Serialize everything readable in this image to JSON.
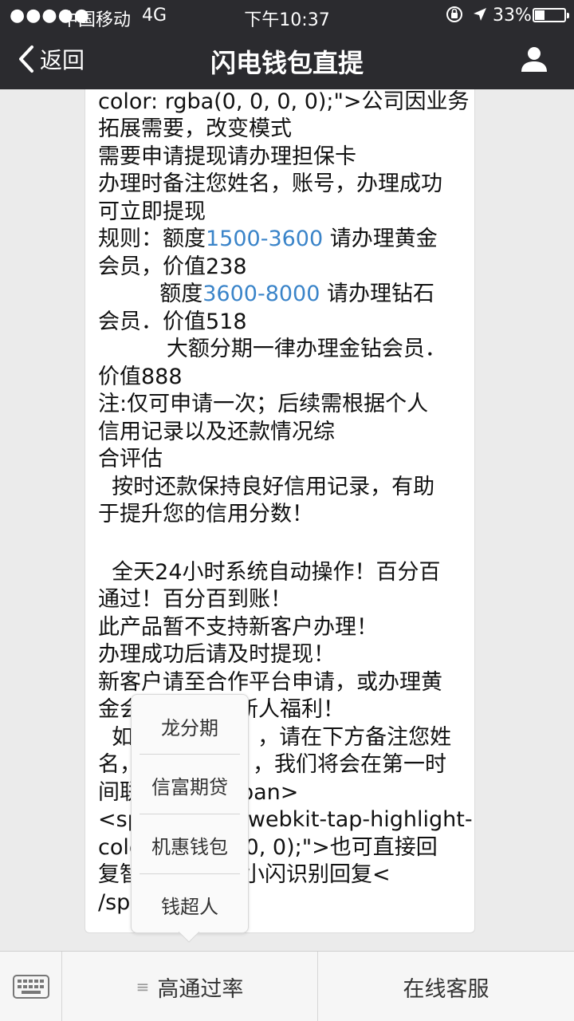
{
  "status_bar": {
    "signal": "●●●●●",
    "carrier": "中国移动",
    "network": "4G",
    "time": "下午10:37",
    "battery_percent_text": "33%",
    "battery_level": 0.33
  },
  "nav": {
    "back_label": "返回",
    "title": "闪电钱包直提"
  },
  "message": {
    "l1": "color: rgba(0, 0, 0, 0);\">公司因业务",
    "l2": "拓展需要，改变模式",
    "l3": "需要申请提现请办理担保卡",
    "l4": "办理时备注您姓名，账号，办理成功",
    "l5": "可立即提现",
    "l6_a": "规则：额度",
    "l6_b": "1500-3600",
    "l6_c": " 请办理黄金",
    "l7": "会员，价值238",
    "l8_a": "         额度",
    "l8_b": "3600-8000",
    "l8_c": " 请办理钻石",
    "l9": "会员．价值518",
    "l10": "          大额分期一律办理金钻会员．",
    "l11": "价值888",
    "l12": "注:仅可申请一次；后续需根据个人",
    "l13": "信用记录以及还款情况综",
    "l14": "合评估",
    "l15": "  按时还款保持良好信用记录，有助",
    "l16": "于提升您的信用分数！",
    "l17": "  全天24小时系统自动操作！百分百",
    "l18": "通过！百分百到账！",
    "l19": "此产品暂不支持新客户办理！",
    "l20": "办理成功后请及时提现！",
    "l21": "新客户请至合作平台申请，或办理黄",
    "l22_a": "金会",
    "l22_b": "新人福利！",
    "l23_a": "  如",
    "l23_b": "，请在下方备注您姓",
    "l24_a": "名，",
    "l24_b": "，我们将会在第一时",
    "l25_a": "间联",
    "l25_b": "pan>",
    "l26_a": "<sp",
    "l26_b": "webkit-tap-highlight-",
    "l27_a": "colo",
    "l27_b": ", 0, 0);\">也可直接回",
    "l28_a": "复智",
    "l28_b": "小闪识别回复<",
    "l29": "/sp"
  },
  "popup_menu": {
    "items": [
      "龙分期",
      "信富期贷",
      "机惠钱包",
      "钱超人"
    ]
  },
  "bottom_bar": {
    "tab1_label": "高通过率",
    "tab2_label": "在线客服"
  },
  "colors": {
    "bar_dark": "#2b2b2f",
    "link_blue": "#3a84c9"
  },
  "icons": [
    "signal-dots-icon",
    "rotation-lock-icon",
    "location-arrow-icon",
    "battery-icon",
    "back-chevron-icon",
    "profile-icon",
    "keyboard-icon",
    "menu-lines-icon"
  ]
}
